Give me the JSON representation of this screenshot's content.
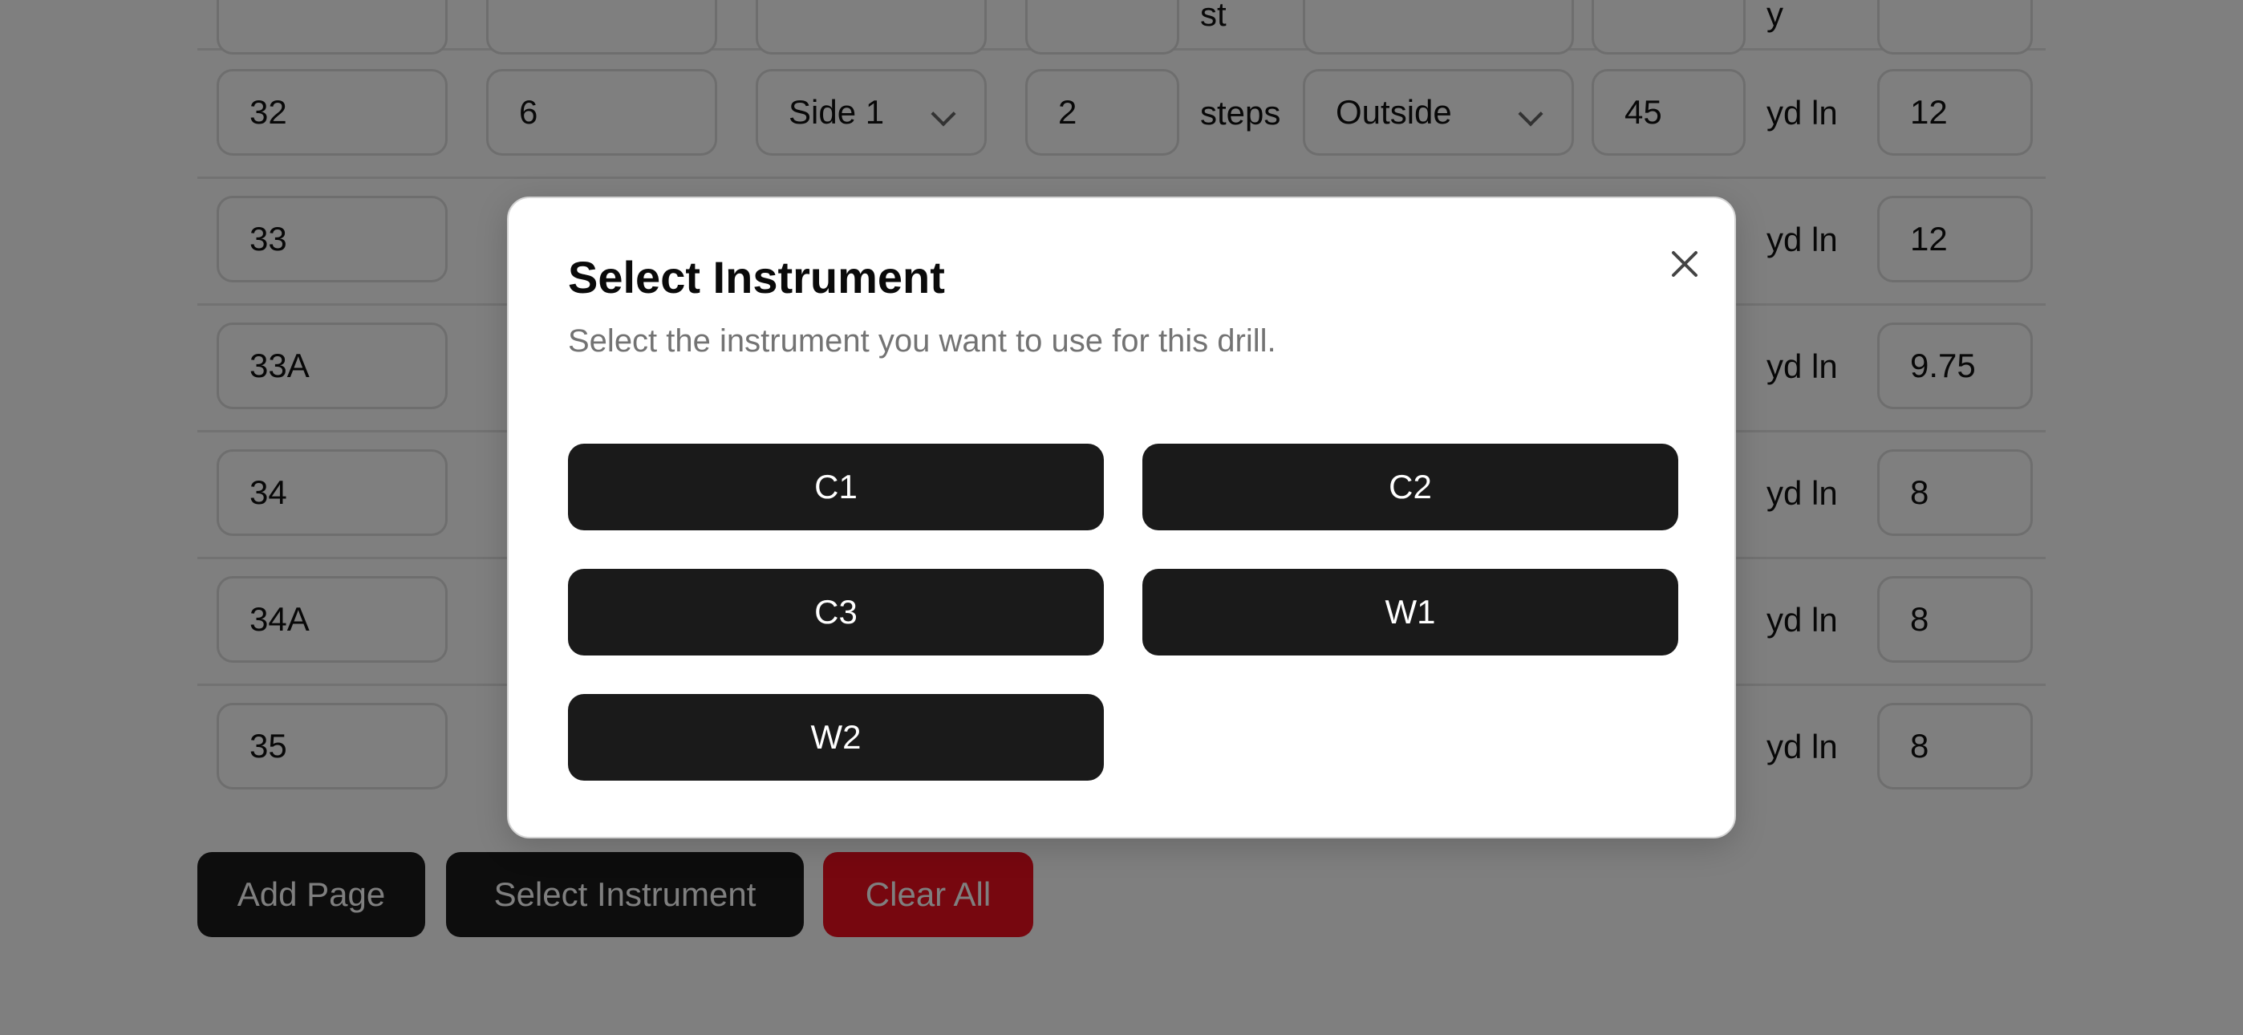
{
  "table": {
    "steps_label": "steps",
    "yard_line_label": "yd ln",
    "rows": [
      {
        "set": "",
        "count": "",
        "side": "",
        "steps": "",
        "inside_outside": "",
        "yard_line": "",
        "front_back": ""
      },
      {
        "set": "32",
        "count": "6",
        "side": "Side 1",
        "steps": "2",
        "inside_outside": "Outside",
        "yard_line": "45",
        "front_back": "12"
      },
      {
        "set": "33",
        "front_back": "12"
      },
      {
        "set": "33A",
        "front_back": "9.75"
      },
      {
        "set": "34",
        "front_back": "8"
      },
      {
        "set": "34A",
        "front_back": "8"
      },
      {
        "set": "35",
        "front_back": "8"
      }
    ]
  },
  "actions": {
    "add_page": "Add Page",
    "select_instrument": "Select Instrument",
    "clear_all": "Clear All"
  },
  "colors": {
    "primary": "#1a1a1a",
    "danger": "#ef0f1f",
    "overlay": "rgba(0,0,0,0.5)"
  },
  "modal": {
    "title": "Select Instrument",
    "description": "Select the instrument you want to use for this drill.",
    "close_icon": "close-icon",
    "options": [
      "C1",
      "C2",
      "C3",
      "W1",
      "W2"
    ]
  }
}
